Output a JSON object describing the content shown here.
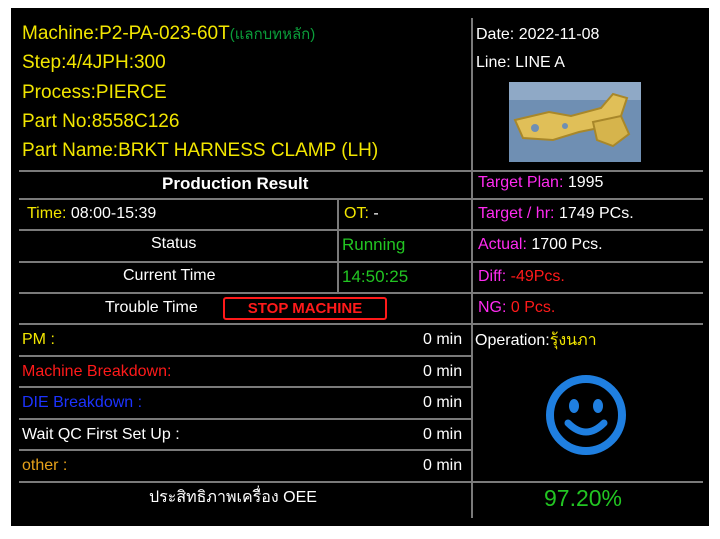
{
  "machine": {
    "label": "Machine:",
    "value": "P2-PA-023-60T",
    "note": "(แลกบทหลัก)"
  },
  "step": {
    "label": "Step:",
    "value": "4/4",
    "jph_label": "JPH:",
    "jph_value": "300"
  },
  "process": {
    "label": "Process:",
    "value": "PIERCE"
  },
  "part_no": {
    "label": "Part No:",
    "value": "8558C126"
  },
  "part_name": {
    "label": "Part Name:",
    "value": "BRKT HARNESS CLAMP (LH)"
  },
  "date": {
    "label": "Date:",
    "value": "2022-11-08"
  },
  "line": {
    "label": "Line:",
    "value": "LINE A"
  },
  "production_result": "Production Result",
  "time": {
    "label": "Time:",
    "value": "08:00-15:39"
  },
  "ot": {
    "label": "OT:",
    "value": "-"
  },
  "status": {
    "label": "Status",
    "value": "Running"
  },
  "current_time": {
    "label": "Current Time",
    "value": "14:50:25"
  },
  "trouble_time": {
    "label": "Trouble Time",
    "button": "STOP MACHINE"
  },
  "target_plan": {
    "label": "Target Plan:",
    "value": "1995"
  },
  "target_hr": {
    "label": "Target / hr:",
    "value": "1749 PCs."
  },
  "actual": {
    "label": "Actual:",
    "value": "1700 Pcs."
  },
  "diff": {
    "label": "Diff:",
    "value": "-49Pcs."
  },
  "ng": {
    "label": "NG:",
    "value": "0 Pcs."
  },
  "downtime": [
    {
      "label": "PM :",
      "value": "0 min"
    },
    {
      "label": "Machine Breakdown:",
      "value": "0 min"
    },
    {
      "label": "DIE Breakdown :",
      "value": "0 min"
    },
    {
      "label": "Wait QC First Set Up :",
      "value": "0 min"
    },
    {
      "label": "other :",
      "value": "0 min"
    }
  ],
  "operation": {
    "label": "Operation:",
    "value": "รุ้งนภา"
  },
  "oee": {
    "label": "ประสิทธิภาพเครื่อง OEE",
    "value": "97.20%"
  },
  "status_icon": "smiley-face-icon",
  "colors": {
    "yellow": "#f2e600",
    "magenta": "#ff2bf0",
    "green": "#22c522",
    "red": "#ff1a1a",
    "blue": "#1c33ff",
    "smiley": "#1f7fe0"
  }
}
